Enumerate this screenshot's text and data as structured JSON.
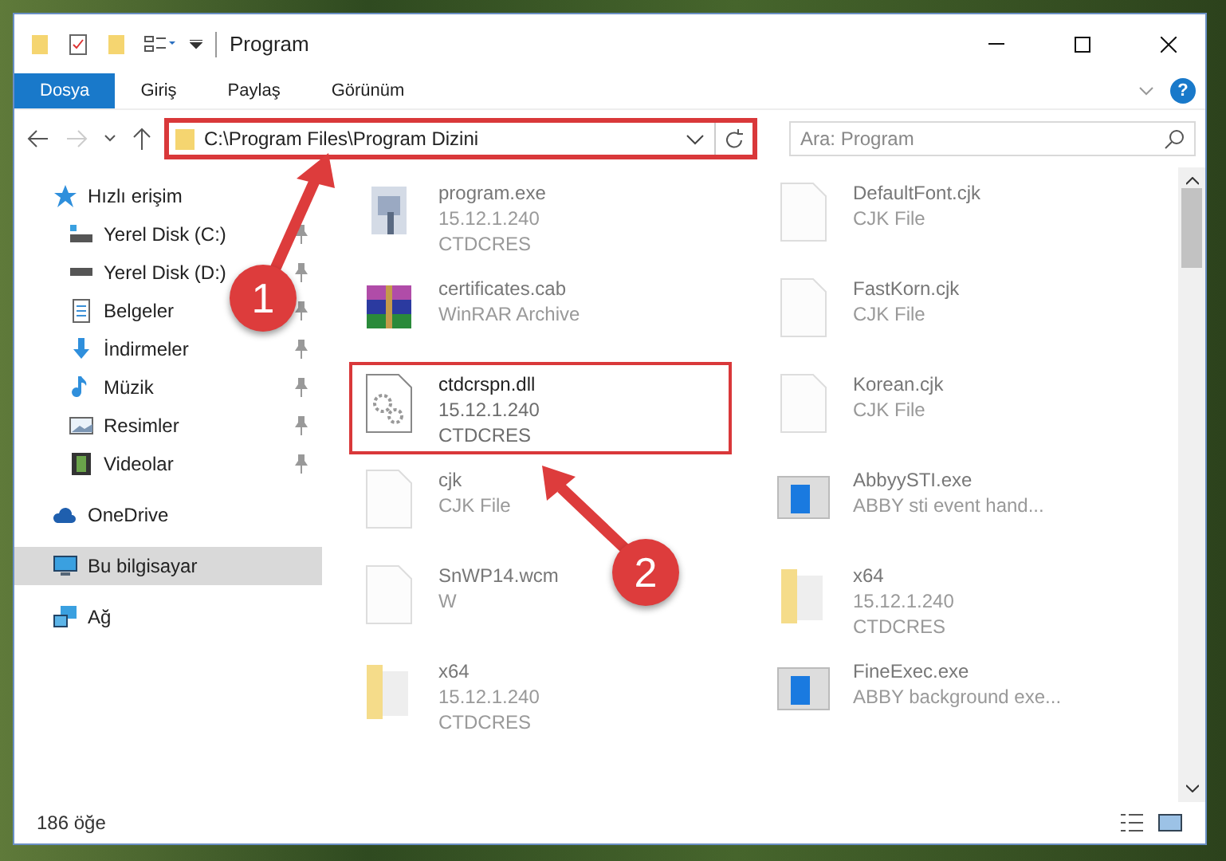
{
  "window": {
    "title": "Program"
  },
  "ribbon": {
    "tabs": [
      {
        "label": "Dosya",
        "selected": true
      },
      {
        "label": "Giriş",
        "selected": false
      },
      {
        "label": "Paylaş",
        "selected": false
      },
      {
        "label": "Görünüm",
        "selected": false
      }
    ],
    "help": "?"
  },
  "address_bar": {
    "path": "C:\\Program Files\\Program Dizini",
    "highlighted": true,
    "forward_disabled": true
  },
  "search": {
    "placeholder": "Ara: Program"
  },
  "sidebar": {
    "items": [
      {
        "label": "Hızlı erişim",
        "kind": "star",
        "selected": false,
        "children": [
          {
            "label": "Yerel Disk (C:)",
            "kind": "system-drive",
            "pinned": true,
            "selected": false
          },
          {
            "label": "Yerel Disk (D:)",
            "kind": "drive",
            "pinned": true,
            "selected": false
          },
          {
            "label": "Belgeler",
            "kind": "document",
            "pinned": true,
            "selected": false
          },
          {
            "label": "İndirmeler",
            "kind": "download",
            "pinned": true,
            "selected": false
          },
          {
            "label": "Müzik",
            "kind": "music",
            "pinned": true,
            "selected": false
          },
          {
            "label": "Resimler",
            "kind": "picture",
            "pinned": true,
            "selected": false
          },
          {
            "label": "Videolar",
            "kind": "film",
            "pinned": true,
            "selected": false
          }
        ]
      },
      {
        "label": "OneDrive",
        "kind": "cloud",
        "selected": false
      },
      {
        "label": "Bu bilgisayar",
        "kind": "monitor",
        "selected": true
      },
      {
        "label": "Ağ",
        "kind": "network",
        "selected": false
      }
    ]
  },
  "files": [
    {
      "name": "program.exe",
      "details": [
        "15.12.1.240",
        "CTDCRES"
      ],
      "kind": "exe",
      "highlighted": false
    },
    {
      "name": "DefaultFont.cjk",
      "details": [
        "CJK File"
      ],
      "kind": "file",
      "highlighted": false
    },
    {
      "name": "certificates.cab",
      "details": [
        "WinRAR Archive"
      ],
      "kind": "archive",
      "highlighted": false
    },
    {
      "name": "FastKorn.cjk",
      "details": [
        "CJK File"
      ],
      "kind": "file",
      "highlighted": false
    },
    {
      "name": "ctdcrspn.dll",
      "details": [
        "15.12.1.240",
        "CTDCRES"
      ],
      "kind": "dll",
      "highlighted": true
    },
    {
      "name": "Korean.cjk",
      "details": [
        "CJK File"
      ],
      "kind": "file",
      "highlighted": false
    },
    {
      "name": "cjk",
      "details": [
        "CJK File"
      ],
      "kind": "file",
      "highlighted": false
    },
    {
      "name": "AbbyySTI.exe",
      "details": [
        "ABBY sti event hand..."
      ],
      "kind": "app",
      "highlighted": false
    },
    {
      "name": "SnWP14.wcm",
      "details": [
        "W"
      ],
      "kind": "file",
      "highlighted": false
    },
    {
      "name": "x64",
      "details": [
        "15.12.1.240",
        "CTDCRES"
      ],
      "kind": "folder",
      "highlighted": false
    },
    {
      "name": "x64",
      "details": [
        "15.12.1.240",
        "CTDCRES"
      ],
      "kind": "folder",
      "highlighted": false
    },
    {
      "name": "FineExec.exe",
      "details": [
        "ABBY background exe..."
      ],
      "kind": "app",
      "highlighted": false
    }
  ],
  "status_bar": {
    "count": "186 öğe"
  },
  "annotations": [
    {
      "label": "1"
    },
    {
      "label": "2"
    }
  ]
}
